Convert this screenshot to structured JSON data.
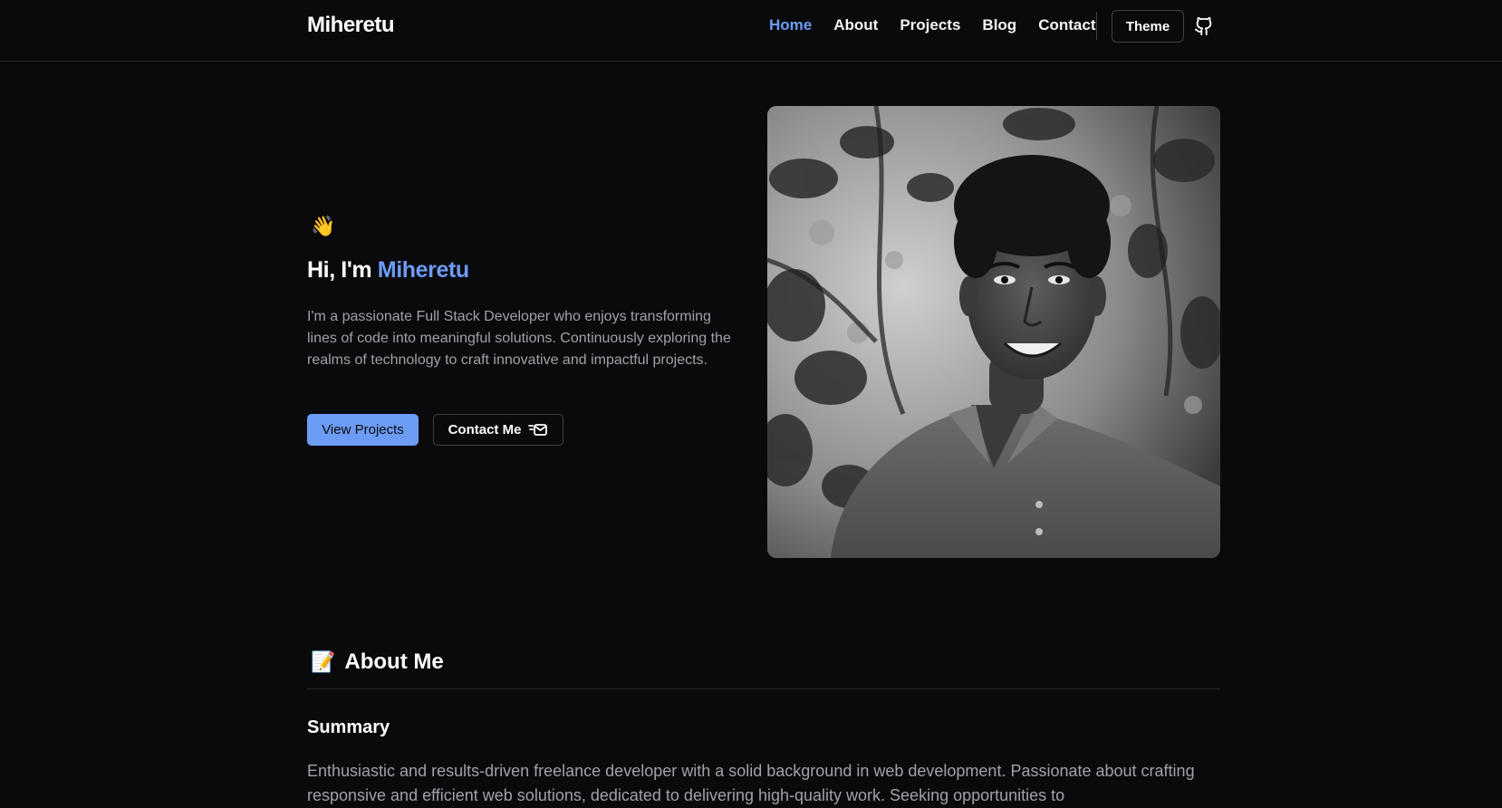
{
  "header": {
    "brand": "Miheretu",
    "nav": [
      {
        "label": "Home",
        "active": true
      },
      {
        "label": "About",
        "active": false
      },
      {
        "label": "Projects",
        "active": false
      },
      {
        "label": "Blog",
        "active": false
      },
      {
        "label": "Contact",
        "active": false
      }
    ],
    "theme_label": "Theme",
    "github_icon": "github-icon"
  },
  "hero": {
    "wave_emoji": "👋",
    "greeting": "Hi, I'm ",
    "name": "Miheretu",
    "description": "I'm a passionate Full Stack Developer who enjoys transforming lines of code into meaningful solutions. Continuously exploring the realms of technology to craft innovative and impactful projects.",
    "primary_button": "View Projects",
    "secondary_button": "Contact Me",
    "secondary_icon": "mail-icon"
  },
  "about": {
    "emoji": "📝",
    "title": "About Me",
    "summary_title": "Summary",
    "summary_text": "Enthusiastic and results-driven freelance developer with a solid background in web development. Passionate about crafting responsive and efficient web solutions, dedicated to delivering high-quality work. Seeking opportunities to"
  },
  "colors": {
    "background": "#0a0a0c",
    "accent": "#6c9cf5",
    "border": "#27272a",
    "muted_text": "#a1a1aa"
  }
}
